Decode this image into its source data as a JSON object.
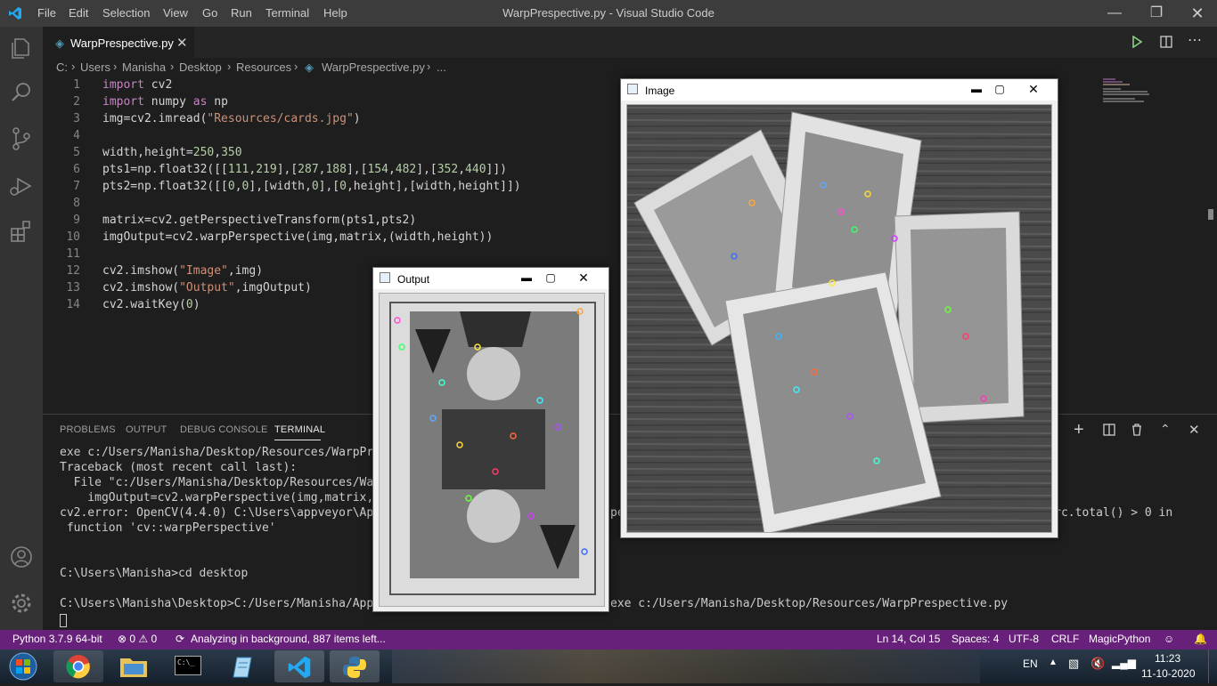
{
  "window": {
    "title": "WarpPrespective.py - Visual Studio Code",
    "menu": [
      "File",
      "Edit",
      "Selection",
      "View",
      "Go",
      "Run",
      "Terminal",
      "Help"
    ]
  },
  "tab": {
    "label": "WarpPrespective.py"
  },
  "breadcrumb": [
    "C:",
    "Users",
    "Manisha",
    "Desktop",
    "Resources",
    "WarpPrespective.py",
    "..."
  ],
  "editor": {
    "lines": [
      "import cv2",
      "import numpy as np",
      "img=cv2.imread(\"Resources/cards.jpg\")",
      "",
      "width,height=250,350",
      "pts1=np.float32([[111,219],[287,188],[154,482],[352,440]])",
      "pts2=np.float32([[0,0],[width,0],[0,height],[width,height]])",
      "",
      "matrix=cv2.getPerspectiveTransform(pts1,pts2)",
      "imgOutput=cv2.warpPerspective(img,matrix,(width,height))",
      "",
      "cv2.imshow(\"Image\",img)",
      "cv2.imshow(\"Output\",imgOutput)",
      "cv2.waitKey(0)"
    ]
  },
  "panel": {
    "tabs": [
      "PROBLEMS",
      "OUTPUT",
      "DEBUG CONSOLE",
      "TERMINAL"
    ],
    "active_tab": "TERMINAL",
    "terminal": [
      "exe c:/Users/Manisha/Desktop/Resources/WarpPrespec",
      "Traceback (most recent call last):",
      "  File \"c:/Users/Manisha/Desktop/Resources/WarpPre",
      "    imgOutput=cv2.warpPerspective(img,matrix,(widt",
      "cv2.error: OpenCV(4.4.0) C:\\Users\\appveyor\\AppData",
      " function 'cv::warpPerspective'",
      "",
      "",
      "C:\\Users\\Manisha>cd desktop",
      "",
      "C:\\Users\\Manisha\\Desktop>C:/Users/Manisha/AppData/"
    ],
    "terminal_right": {
      "error_tail_prefix": "pe",
      "error_tail": "d) _src.total() > 0 in",
      "command_tail": "exe c:/Users/Manisha/Desktop/Resources/WarpPrespective.py"
    }
  },
  "cv_windows": {
    "image": {
      "title": "Image"
    },
    "output": {
      "title": "Output"
    }
  },
  "status": {
    "python": "Python 3.7.9 64-bit",
    "problems": "⊗ 0 ⚠ 0",
    "analyzing": "Analyzing in background, 887 items left...",
    "position": "Ln 14, Col 15",
    "spaces": "Spaces: 4",
    "encoding": "UTF-8",
    "eol": "CRLF",
    "language": "MagicPython"
  },
  "taskbar": {
    "lang": "EN",
    "time": "11:23",
    "date": "11-10-2020"
  },
  "colors": {
    "status_bar": "#68217a",
    "title_bar": "#3c3c3c",
    "editor_bg": "#1e1e1e"
  }
}
